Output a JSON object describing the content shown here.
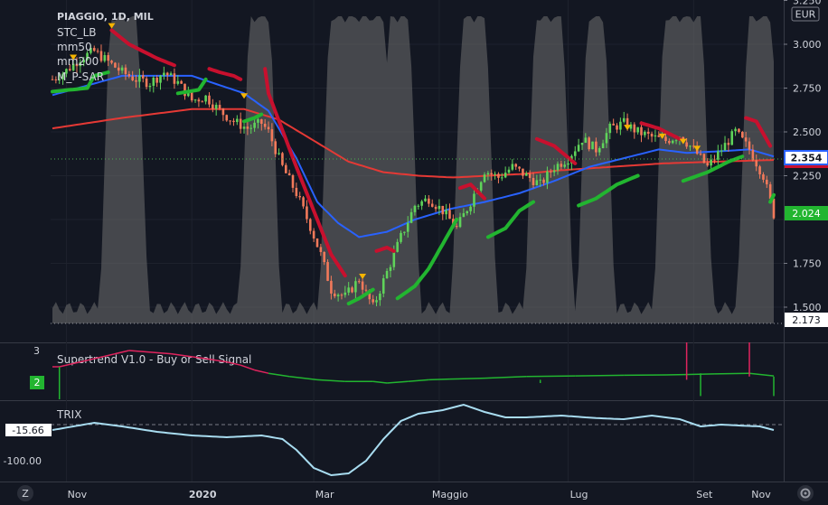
{
  "symbol": "PIAGGIO, 1D, MIL",
  "legend": [
    "STC_LB",
    "mm50",
    "mm200",
    "M_P-SAR"
  ],
  "currency": "EUR",
  "price_tags": {
    "last": "2.354",
    "close": "2.024",
    "other": "2.173"
  },
  "indicator1": {
    "name": "Supertrend V1.0 - Buy or Sell Signal",
    "scale_top": "3",
    "tag": "2"
  },
  "indicator2": {
    "name": "TRIX",
    "tag": "-15.66"
  },
  "footer": {
    "left_icon": "Z",
    "right_icon": "gear"
  },
  "colors": {
    "background": "#131722",
    "up": "#26a69a",
    "down": "#ef5350",
    "mm50": "#2962ff",
    "mm200": "#e53935",
    "stc": "#6f6f6f",
    "supertrend_up": "#22b530",
    "supertrend_down": "#c8102e",
    "trix": "#a8dcf0"
  },
  "chart_data": {
    "type": "candlestick",
    "x_labels": [
      "Nov",
      "2020",
      "Mar",
      "Maggio",
      "Lug",
      "Set",
      "Nov"
    ],
    "y_ticks": [
      "3.250",
      "3.000",
      "2.750",
      "2.500",
      "2.250",
      "1.750",
      "1.500"
    ],
    "ylim": [
      1.4,
      3.25
    ],
    "price_path": [
      [
        0,
        2.8
      ],
      [
        4,
        2.85
      ],
      [
        8,
        2.92
      ],
      [
        12,
        2.96
      ],
      [
        16,
        2.9
      ],
      [
        20,
        2.84
      ],
      [
        24,
        2.8
      ],
      [
        28,
        2.78
      ],
      [
        32,
        2.84
      ],
      [
        36,
        2.78
      ],
      [
        40,
        2.68
      ],
      [
        44,
        2.7
      ],
      [
        48,
        2.62
      ],
      [
        52,
        2.56
      ],
      [
        56,
        2.52
      ],
      [
        60,
        2.55
      ],
      [
        62,
        2.5
      ],
      [
        66,
        2.3
      ],
      [
        70,
        2.15
      ],
      [
        74,
        1.96
      ],
      [
        77,
        1.8
      ],
      [
        80,
        1.6
      ],
      [
        84,
        1.56
      ],
      [
        88,
        1.66
      ],
      [
        92,
        1.5
      ],
      [
        96,
        1.7
      ],
      [
        100,
        1.9
      ],
      [
        104,
        2.08
      ],
      [
        108,
        2.12
      ],
      [
        112,
        2.05
      ],
      [
        116,
        1.95
      ],
      [
        120,
        2.1
      ],
      [
        124,
        2.28
      ],
      [
        128,
        2.24
      ],
      [
        132,
        2.3
      ],
      [
        136,
        2.25
      ],
      [
        140,
        2.2
      ],
      [
        144,
        2.3
      ],
      [
        148,
        2.35
      ],
      [
        152,
        2.46
      ],
      [
        156,
        2.4
      ],
      [
        160,
        2.52
      ],
      [
        164,
        2.55
      ],
      [
        168,
        2.5
      ],
      [
        172,
        2.47
      ],
      [
        176,
        2.45
      ],
      [
        180,
        2.48
      ],
      [
        184,
        2.4
      ],
      [
        188,
        2.3
      ],
      [
        192,
        2.4
      ],
      [
        196,
        2.5
      ],
      [
        200,
        2.4
      ],
      [
        204,
        2.25
      ],
      [
        207,
        2.03
      ]
    ],
    "mm50": [
      [
        0,
        2.71
      ],
      [
        20,
        2.82
      ],
      [
        40,
        2.82
      ],
      [
        55,
        2.72
      ],
      [
        62,
        2.62
      ],
      [
        70,
        2.35
      ],
      [
        76,
        2.1
      ],
      [
        82,
        1.98
      ],
      [
        88,
        1.9
      ],
      [
        96,
        1.93
      ],
      [
        104,
        2.0
      ],
      [
        114,
        2.06
      ],
      [
        124,
        2.1
      ],
      [
        134,
        2.15
      ],
      [
        144,
        2.22
      ],
      [
        154,
        2.3
      ],
      [
        164,
        2.35
      ],
      [
        174,
        2.4
      ],
      [
        182,
        2.38
      ],
      [
        192,
        2.39
      ],
      [
        200,
        2.4
      ],
      [
        207,
        2.36
      ]
    ],
    "mm200": [
      [
        0,
        2.52
      ],
      [
        20,
        2.58
      ],
      [
        40,
        2.63
      ],
      [
        55,
        2.63
      ],
      [
        65,
        2.57
      ],
      [
        75,
        2.45
      ],
      [
        85,
        2.33
      ],
      [
        95,
        2.27
      ],
      [
        105,
        2.25
      ],
      [
        115,
        2.24
      ],
      [
        125,
        2.25
      ],
      [
        135,
        2.26
      ],
      [
        145,
        2.28
      ],
      [
        160,
        2.3
      ],
      [
        175,
        2.32
      ],
      [
        190,
        2.33
      ],
      [
        207,
        2.34
      ]
    ],
    "supertrend": [
      {
        "trend": "up",
        "points": [
          [
            0,
            2.73
          ],
          [
            10,
            2.75
          ],
          [
            12,
            2.82
          ],
          [
            16,
            2.84
          ]
        ]
      },
      {
        "trend": "down",
        "points": [
          [
            17,
            3.08
          ],
          [
            22,
            3.0
          ],
          [
            30,
            2.92
          ],
          [
            35,
            2.88
          ]
        ]
      },
      {
        "trend": "up",
        "points": [
          [
            36,
            2.72
          ],
          [
            42,
            2.74
          ],
          [
            44,
            2.8
          ]
        ]
      },
      {
        "trend": "down",
        "points": [
          [
            45,
            2.86
          ],
          [
            48,
            2.84
          ],
          [
            52,
            2.82
          ],
          [
            54,
            2.8
          ]
        ]
      },
      {
        "trend": "up",
        "points": [
          [
            55,
            2.56
          ],
          [
            58,
            2.58
          ],
          [
            60,
            2.6
          ]
        ]
      },
      {
        "trend": "down",
        "points": [
          [
            61,
            2.86
          ],
          [
            62,
            2.72
          ],
          [
            70,
            2.3
          ],
          [
            76,
            2.0
          ],
          [
            80,
            1.8
          ],
          [
            84,
            1.68
          ]
        ]
      },
      {
        "trend": "up",
        "points": [
          [
            85,
            1.52
          ],
          [
            88,
            1.55
          ],
          [
            92,
            1.6
          ]
        ]
      },
      {
        "trend": "down",
        "points": [
          [
            93,
            1.82
          ],
          [
            96,
            1.84
          ],
          [
            98,
            1.82
          ]
        ]
      },
      {
        "trend": "up",
        "points": [
          [
            99,
            1.55
          ],
          [
            104,
            1.62
          ],
          [
            108,
            1.72
          ],
          [
            112,
            1.86
          ],
          [
            116,
            2.0
          ]
        ]
      },
      {
        "trend": "down",
        "points": [
          [
            117,
            2.18
          ],
          [
            120,
            2.2
          ],
          [
            124,
            2.12
          ]
        ]
      },
      {
        "trend": "up",
        "points": [
          [
            125,
            1.9
          ],
          [
            130,
            1.95
          ],
          [
            134,
            2.05
          ],
          [
            138,
            2.1
          ]
        ]
      },
      {
        "trend": "down",
        "points": [
          [
            139,
            2.46
          ],
          [
            144,
            2.42
          ],
          [
            150,
            2.32
          ]
        ]
      },
      {
        "trend": "up",
        "points": [
          [
            151,
            2.08
          ],
          [
            156,
            2.12
          ],
          [
            162,
            2.2
          ],
          [
            168,
            2.25
          ]
        ]
      },
      {
        "trend": "down",
        "points": [
          [
            169,
            2.55
          ],
          [
            174,
            2.52
          ],
          [
            180,
            2.46
          ]
        ]
      },
      {
        "trend": "up",
        "points": [
          [
            181,
            2.22
          ],
          [
            188,
            2.27
          ],
          [
            194,
            2.33
          ],
          [
            198,
            2.36
          ]
        ]
      },
      {
        "trend": "down",
        "points": [
          [
            199,
            2.58
          ],
          [
            202,
            2.56
          ],
          [
            206,
            2.42
          ]
        ]
      },
      {
        "trend": "up",
        "points": [
          [
            206,
            2.1
          ],
          [
            207,
            2.14
          ]
        ]
      }
    ],
    "stc_peaks": [
      [
        17,
        24
      ],
      [
        57,
        62
      ],
      [
        80,
        95
      ],
      [
        97,
        102
      ],
      [
        118,
        124
      ],
      [
        139,
        146
      ],
      [
        154,
        158
      ],
      [
        176,
        186
      ],
      [
        200,
        206
      ]
    ],
    "signals": [
      [
        6,
        2.92
      ],
      [
        17,
        3.1
      ],
      [
        55,
        2.7
      ],
      [
        89,
        1.67
      ],
      [
        165,
        2.52
      ],
      [
        175,
        2.47
      ],
      [
        181,
        2.44
      ],
      [
        185,
        2.4
      ]
    ],
    "supertrend_signal": [
      [
        0,
        2.5
      ],
      [
        2,
        2.5
      ],
      [
        22,
        3.0
      ],
      [
        34,
        2.9
      ],
      [
        44,
        2.75
      ],
      [
        50,
        2.65
      ],
      [
        54,
        2.55
      ],
      [
        58,
        2.4
      ],
      [
        62,
        2.3
      ],
      [
        68,
        2.2
      ],
      [
        76,
        2.1
      ],
      [
        84,
        2.05
      ],
      [
        92,
        2.05
      ],
      [
        96,
        2.0
      ],
      [
        102,
        2.05
      ],
      [
        108,
        2.1
      ],
      [
        114,
        2.12
      ],
      [
        124,
        2.15
      ],
      [
        136,
        2.2
      ],
      [
        150,
        2.22
      ],
      [
        164,
        2.24
      ],
      [
        176,
        2.25
      ],
      [
        190,
        2.28
      ],
      [
        200,
        2.3
      ],
      [
        207,
        2.22
      ]
    ],
    "trix": [
      [
        0,
        -15
      ],
      [
        12,
        5
      ],
      [
        20,
        -5
      ],
      [
        30,
        -20
      ],
      [
        40,
        -30
      ],
      [
        50,
        -35
      ],
      [
        60,
        -30
      ],
      [
        66,
        -40
      ],
      [
        70,
        -70
      ],
      [
        75,
        -120
      ],
      [
        80,
        -140
      ],
      [
        85,
        -135
      ],
      [
        90,
        -100
      ],
      [
        95,
        -40
      ],
      [
        100,
        10
      ],
      [
        105,
        30
      ],
      [
        112,
        40
      ],
      [
        118,
        55
      ],
      [
        124,
        35
      ],
      [
        130,
        20
      ],
      [
        136,
        20
      ],
      [
        146,
        25
      ],
      [
        156,
        18
      ],
      [
        164,
        15
      ],
      [
        172,
        25
      ],
      [
        180,
        15
      ],
      [
        186,
        -5
      ],
      [
        192,
        0
      ],
      [
        198,
        -3
      ],
      [
        203,
        -5
      ],
      [
        207,
        -15
      ]
    ]
  }
}
